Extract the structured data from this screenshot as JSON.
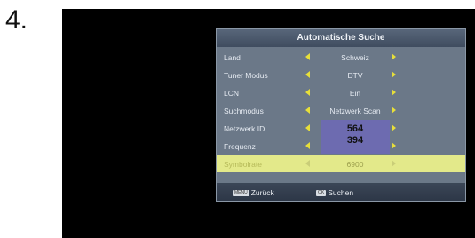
{
  "step_number": "4.",
  "osd": {
    "title": "Automatische Suche",
    "rows": [
      {
        "label": "Land",
        "value": "Schweiz"
      },
      {
        "label": "Tuner Modus",
        "value": "DTV"
      },
      {
        "label": "LCN",
        "value": "Ein"
      },
      {
        "label": "Suchmodus",
        "value": "Netzwerk Scan"
      },
      {
        "label": "Netzwerk ID",
        "value": "564"
      },
      {
        "label": "Frequenz",
        "value": "394"
      },
      {
        "label": "Symbolrate",
        "value": "6900"
      }
    ],
    "footer": {
      "back_key": "MENU",
      "back_label": "Zurück",
      "ok_key": "OK",
      "ok_label": "Suchen"
    }
  },
  "colors": {
    "panel": "#6b7888",
    "highlight_row": "#e3e98a",
    "arrow": "#e7df3a",
    "number_box": "#6d6bb0"
  }
}
